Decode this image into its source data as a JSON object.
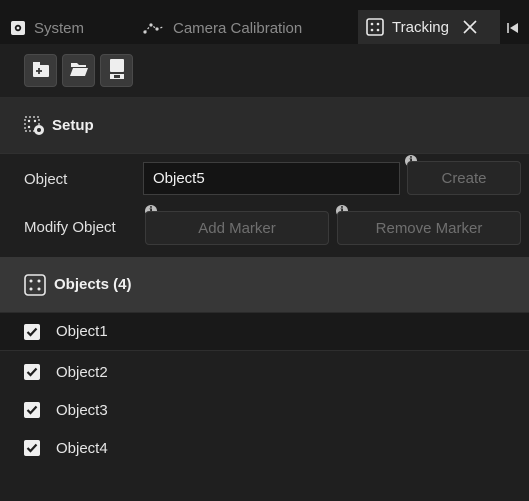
{
  "tabs": [
    {
      "label": "System",
      "icon": "gear-icon",
      "active": false
    },
    {
      "label": "Camera Calibration",
      "icon": "camera-calibration-icon",
      "active": false
    },
    {
      "label": "Tracking",
      "icon": "tracking-icon",
      "active": true
    }
  ],
  "toolbar": {
    "buttons": [
      {
        "icon": "new-file-icon"
      },
      {
        "icon": "open-folder-icon"
      },
      {
        "icon": "save-icon"
      }
    ]
  },
  "setup": {
    "title": "Setup",
    "object_label": "Object",
    "object_value": "Object5",
    "create_label": "Create",
    "modify_label": "Modify Object",
    "add_marker_label": "Add Marker",
    "remove_marker_label": "Remove Marker"
  },
  "objects": {
    "title": "Objects (4)",
    "items": [
      {
        "label": "Object1",
        "checked": true
      },
      {
        "label": "Object2",
        "checked": true
      },
      {
        "label": "Object3",
        "checked": true
      },
      {
        "label": "Object4",
        "checked": true
      }
    ]
  },
  "colors": {
    "background": "#1f1f1f",
    "section_header": "#373737",
    "checkbox": "#efefef"
  }
}
